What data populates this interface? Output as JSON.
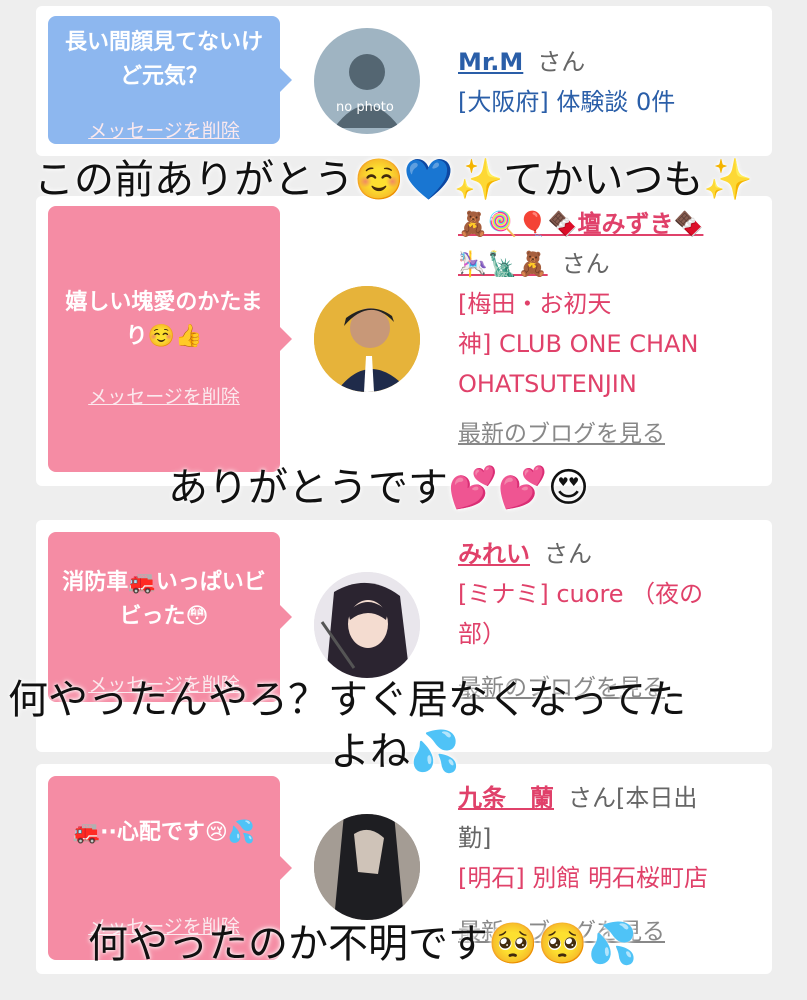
{
  "cards": [
    {
      "message": "長い間顔見てないけど元気？",
      "delete_label": "メッセージを削除",
      "name": "Mr.M",
      "san": "さん",
      "lines": [
        "[大阪府] 体験談 0件"
      ],
      "avatar_text": "no photo"
    },
    {
      "message": "嬉しい塊愛のかたまり☺️👍",
      "delete_label": "メッセージを削除",
      "name": "🧸🍭🎈🍫壇みずき🍫",
      "name_line2": "🎠🗽🧸",
      "san": "さん",
      "lines": [
        "[梅田・お初天",
        "神] CLUB ONE CHAN",
        "OHATSUTENJIN"
      ],
      "blog_link": "最新のブログを見る"
    },
    {
      "message": "消防車🚒いっぱいビビった😳",
      "delete_label": "メッセージを削除",
      "name": "みれい",
      "san": "さん",
      "lines": [
        "[ミナミ] cuore （夜の",
        "部）"
      ],
      "blog_link": "最新のブログを見る"
    },
    {
      "message": "🚒··心配です😢💦",
      "delete_label": "メッセージを削除",
      "name": "九条　蘭",
      "san": "さん[本日出",
      "name_line2": "勤]",
      "lines": [
        "[明石] 別館 明石桜町店"
      ],
      "blog_link": "最新のブログを見る"
    }
  ],
  "overlays": [
    "この前ありがとう☺️💙✨てかいつも✨",
    "ありがとうです💕💕😍",
    "何やったんやろ？すぐ居なくなってた",
    "よね💦",
    "何やったのか不明です🥺🥺💦"
  ],
  "colors": {
    "blue_bubble": "#8db7ef",
    "pink_bubble": "#f58ca4",
    "blue_name": "#2a5ea8",
    "pink_name": "#e0416a"
  }
}
